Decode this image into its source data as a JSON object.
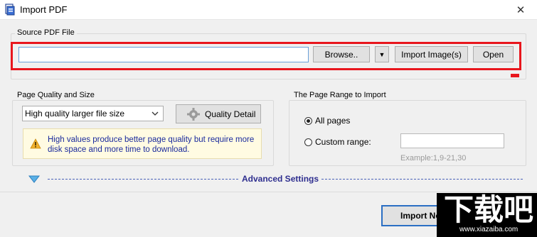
{
  "window": {
    "title": "Import PDF",
    "close_symbol": "✕"
  },
  "source": {
    "group_label": "Source PDF File",
    "path_value": "",
    "browse_label": "Browse..",
    "dropdown_symbol": "▼",
    "import_images_label": "Import Image(s)",
    "open_label": "Open"
  },
  "quality": {
    "group_label": "Page Quality and Size",
    "selected_option": "High quality larger file size",
    "detail_button_label": "Quality Detail",
    "warning_text": "High values produce better page quality but require more disk space and more time to download."
  },
  "range": {
    "group_label": "The Page Range to Import",
    "all_pages_label": "All pages",
    "all_pages_selected": true,
    "custom_range_label": "Custom range:",
    "custom_range_value": "",
    "example_text": "Example:1,9-21,30"
  },
  "advanced": {
    "label": "Advanced Settings"
  },
  "footer": {
    "import_button_label": "Import No"
  },
  "watermark": {
    "big_text": "下载吧",
    "small_text": "www.xiazaiba.com"
  },
  "colors": {
    "highlight": "#e8161d",
    "accent": "#2e2e8f",
    "warning_text": "#1a2a9c"
  }
}
